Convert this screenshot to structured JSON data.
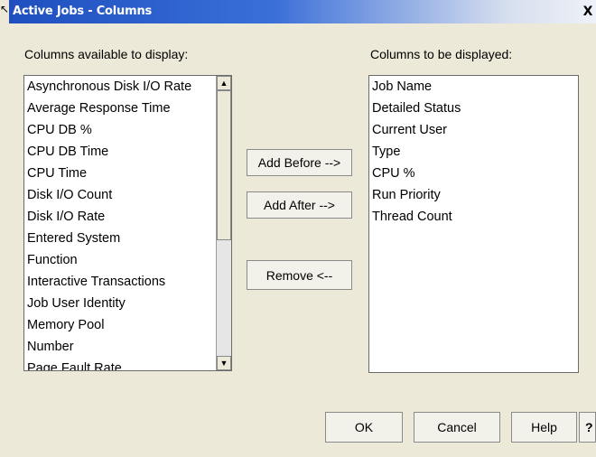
{
  "window": {
    "title": "Active Jobs - Columns",
    "close_glyph": "X"
  },
  "available": {
    "label": "Columns available to display:",
    "items": [
      "Asynchronous Disk I/O Rate",
      "Average Response Time",
      "CPU DB %",
      "CPU DB Time",
      "CPU Time",
      "Disk I/O Count",
      "Disk I/O Rate",
      "Entered System",
      "Function",
      "Interactive Transactions",
      "Job User Identity",
      "Memory Pool",
      "Number",
      "Page Fault Rate"
    ]
  },
  "displayed": {
    "label": "Columns to be displayed:",
    "items": [
      "Job Name",
      "Detailed Status",
      "Current User",
      "Type",
      "CPU %",
      "Run Priority",
      "Thread Count"
    ]
  },
  "actions": {
    "add_before": "Add Before -->",
    "add_after": "Add After -->",
    "remove": "Remove <--"
  },
  "footer": {
    "ok": "OK",
    "cancel": "Cancel",
    "help": "Help",
    "question": "?"
  },
  "icons": {
    "scroll_up": "up-arrow-icon",
    "scroll_down": "down-arrow-icon"
  }
}
